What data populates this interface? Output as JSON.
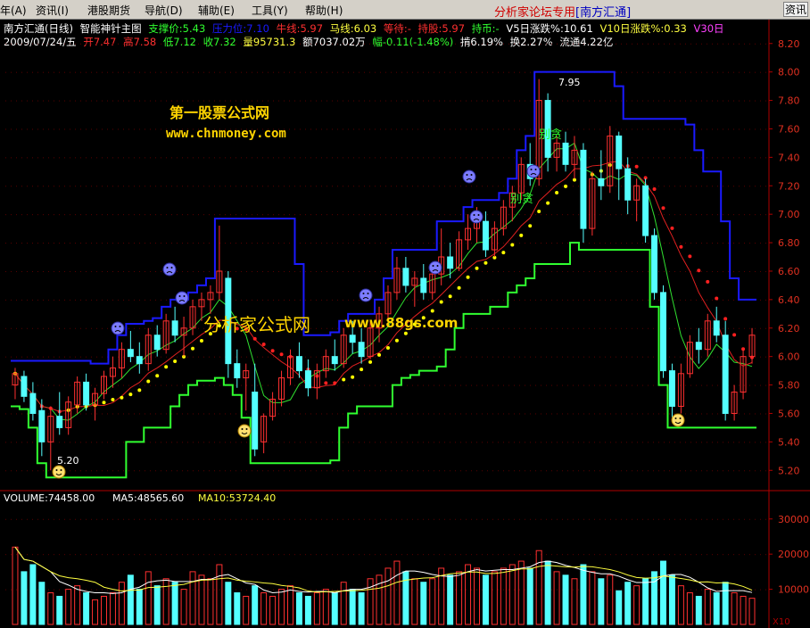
{
  "menu": {
    "items": [
      "年(A)",
      "资讯(I)",
      "港股期货",
      "导航(D)",
      "辅助(E)",
      "工具(Y)",
      "帮助(H)"
    ],
    "brand": "分析家论坛专用",
    "stock_tag": "[南方汇通]",
    "right_button": "资讯"
  },
  "header": {
    "title": "南方汇通(日线)",
    "indicator": "智能神针主图",
    "support": "支撑价:5.43",
    "pressure": "压力位:7.10",
    "niu": "牛线:5.97",
    "ma": "马线:6.03",
    "wait": "等待:-",
    "hold": "持股:5.97",
    "hold_cash": "持币:-",
    "v5": "V5日涨跌%:10.61",
    "v10": "V10日涨跌%:0.33",
    "v30": "V30日"
  },
  "quote": {
    "date": "2009/07/24/五",
    "open": "开7.47",
    "high": "高7.58",
    "low": "低7.12",
    "close": "收7.32",
    "vol": "量95731.3",
    "amount": "额7037.02万",
    "change": "幅-0.11(-1.48%)",
    "amplitude": "掯6.19%",
    "turnover": "换2.27%",
    "float": "流通4.22亿"
  },
  "watermarks": {
    "site1": "第一股票公式网",
    "url1": "www.chnmoney.com",
    "site2": "分析家公式网",
    "url2": "www.88gs.com"
  },
  "annotations": {
    "low_mark": "5.20",
    "high_mark": "7.95",
    "bietan1": "别贪",
    "bietan2": "别贪"
  },
  "volume_header": {
    "volume": "VOLUME:74458.00",
    "ma5": "MA5:48565.60",
    "ma10": "MA10:53724.40"
  },
  "volume_axis": [
    "30000",
    "20000",
    "10000"
  ],
  "volume_unit": "X10",
  "colors": {
    "up": "#ff3030",
    "down": "#54ffff",
    "pressure_line": "#1a1aff",
    "support_line": "#30ff30",
    "dots": "#ffff00",
    "red_dots": "#ff2020",
    "ma_green": "#30e030",
    "ma_red": "#e02020",
    "axis": "#b00000",
    "grid": "#5a0000"
  },
  "chart_data": {
    "type": "candlestick",
    "price_axis": {
      "ticks": [
        5.2,
        5.4,
        5.6,
        5.8,
        6.0,
        6.2,
        6.4,
        6.6,
        6.8,
        7.0,
        7.2,
        7.4,
        7.6,
        7.8,
        8.0,
        8.2
      ],
      "ylim": [
        5.07,
        8.28
      ]
    },
    "volume_axis": {
      "ticks": [
        10000,
        20000,
        30000
      ],
      "ylim": [
        0,
        34000
      ]
    },
    "candles": [
      [
        5.8,
        5.92,
        5.7,
        5.88,
        22000
      ],
      [
        5.86,
        5.9,
        5.68,
        5.72,
        15000
      ],
      [
        5.74,
        5.82,
        5.55,
        5.6,
        17000
      ],
      [
        5.62,
        5.7,
        5.3,
        5.4,
        12000
      ],
      [
        5.4,
        5.65,
        5.2,
        5.58,
        9000
      ],
      [
        5.58,
        5.75,
        5.45,
        5.5,
        8000
      ],
      [
        5.5,
        5.72,
        5.45,
        5.68,
        10000
      ],
      [
        5.66,
        5.86,
        5.6,
        5.82,
        11000
      ],
      [
        5.82,
        5.88,
        5.62,
        5.66,
        9000
      ],
      [
        5.66,
        5.78,
        5.55,
        5.74,
        7000
      ],
      [
        5.74,
        5.9,
        5.7,
        5.86,
        8000
      ],
      [
        5.86,
        6.0,
        5.78,
        5.92,
        9000
      ],
      [
        5.92,
        6.1,
        5.85,
        6.05,
        12000
      ],
      [
        6.05,
        6.18,
        5.96,
        6.0,
        14000
      ],
      [
        6.0,
        6.1,
        5.88,
        5.95,
        10000
      ],
      [
        5.95,
        6.2,
        5.9,
        6.15,
        15000
      ],
      [
        6.15,
        6.22,
        6.0,
        6.05,
        11000
      ],
      [
        6.05,
        6.3,
        6.02,
        6.25,
        13000
      ],
      [
        6.25,
        6.35,
        6.1,
        6.15,
        12000
      ],
      [
        6.15,
        6.28,
        6.0,
        6.2,
        10000
      ],
      [
        6.2,
        6.4,
        6.15,
        6.35,
        15000
      ],
      [
        6.35,
        6.45,
        6.25,
        6.4,
        14000
      ],
      [
        6.4,
        6.5,
        6.3,
        6.45,
        13000
      ],
      [
        6.45,
        6.92,
        6.4,
        6.6,
        17000
      ],
      [
        6.55,
        6.6,
        5.85,
        5.95,
        12000
      ],
      [
        5.95,
        6.05,
        5.78,
        5.85,
        9000
      ],
      [
        5.85,
        5.95,
        5.62,
        5.9,
        8000
      ],
      [
        5.75,
        5.95,
        5.3,
        5.35,
        11000
      ],
      [
        5.4,
        5.6,
        5.32,
        5.58,
        9000
      ],
      [
        5.58,
        5.75,
        5.55,
        5.7,
        8000
      ],
      [
        5.7,
        5.9,
        5.65,
        5.85,
        10000
      ],
      [
        5.85,
        6.05,
        5.8,
        6.0,
        11000
      ],
      [
        6.0,
        6.1,
        5.85,
        5.9,
        9000
      ],
      [
        5.9,
        5.98,
        5.72,
        5.78,
        8000
      ],
      [
        5.78,
        5.95,
        5.7,
        5.9,
        9000
      ],
      [
        5.9,
        6.05,
        5.85,
        6.0,
        10000
      ],
      [
        6.0,
        6.12,
        5.9,
        5.95,
        9000
      ],
      [
        5.95,
        6.2,
        5.92,
        6.15,
        12000
      ],
      [
        6.15,
        6.25,
        6.02,
        6.1,
        10000
      ],
      [
        6.1,
        6.2,
        5.95,
        6.0,
        9000
      ],
      [
        6.0,
        6.25,
        5.98,
        6.2,
        13000
      ],
      [
        6.2,
        6.35,
        6.1,
        6.3,
        14000
      ],
      [
        6.3,
        6.5,
        6.25,
        6.45,
        16000
      ],
      [
        6.45,
        6.7,
        6.4,
        6.62,
        18000
      ],
      [
        6.62,
        6.7,
        6.45,
        6.5,
        15000
      ],
      [
        6.5,
        6.6,
        6.35,
        6.55,
        13000
      ],
      [
        6.55,
        6.65,
        6.4,
        6.45,
        12000
      ],
      [
        6.45,
        6.62,
        6.4,
        6.58,
        13000
      ],
      [
        6.58,
        6.9,
        6.5,
        6.7,
        16000
      ],
      [
        6.7,
        6.8,
        6.55,
        6.62,
        14000
      ],
      [
        6.62,
        6.88,
        6.6,
        6.82,
        15000
      ],
      [
        6.82,
        7.0,
        6.75,
        6.9,
        17000
      ],
      [
        6.9,
        7.05,
        6.8,
        6.95,
        16000
      ],
      [
        6.95,
        7.02,
        6.7,
        6.75,
        14000
      ],
      [
        6.75,
        6.95,
        6.7,
        6.9,
        15000
      ],
      [
        6.9,
        7.1,
        6.85,
        7.05,
        16000
      ],
      [
        7.05,
        7.2,
        6.95,
        7.15,
        17000
      ],
      [
        7.15,
        7.4,
        7.1,
        7.35,
        18000
      ],
      [
        7.35,
        7.5,
        7.2,
        7.25,
        16000
      ],
      [
        7.25,
        7.95,
        7.2,
        7.8,
        21000
      ],
      [
        7.8,
        7.85,
        7.3,
        7.4,
        18000
      ],
      [
        7.4,
        7.55,
        7.3,
        7.5,
        15000
      ],
      [
        7.5,
        7.58,
        7.3,
        7.35,
        14000
      ],
      [
        7.35,
        7.55,
        7.25,
        7.45,
        13000
      ],
      [
        7.45,
        7.5,
        6.8,
        6.9,
        17000
      ],
      [
        6.9,
        7.3,
        6.85,
        7.25,
        15000
      ],
      [
        7.25,
        7.45,
        7.1,
        7.2,
        13000
      ],
      [
        7.2,
        7.62,
        7.15,
        7.55,
        14000
      ],
      [
        7.55,
        7.58,
        7.1,
        7.32,
        9573
      ],
      [
        7.32,
        7.4,
        7.0,
        7.1,
        12000
      ],
      [
        7.1,
        7.25,
        6.95,
        7.2,
        11000
      ],
      [
        7.2,
        7.25,
        6.8,
        6.85,
        13000
      ],
      [
        6.85,
        6.9,
        6.4,
        6.45,
        15000
      ],
      [
        6.45,
        6.5,
        5.85,
        5.9,
        18000
      ],
      [
        5.9,
        5.95,
        5.55,
        5.65,
        14000
      ],
      [
        5.65,
        5.95,
        5.6,
        5.88,
        11000
      ],
      [
        5.88,
        6.15,
        5.85,
        6.1,
        9000
      ],
      [
        6.1,
        6.2,
        5.95,
        6.05,
        8000
      ],
      [
        6.05,
        6.3,
        6.0,
        6.25,
        10000
      ],
      [
        6.25,
        6.35,
        6.1,
        6.15,
        9000
      ],
      [
        6.15,
        6.25,
        5.55,
        5.6,
        12000
      ],
      [
        5.6,
        5.8,
        5.55,
        5.75,
        9000
      ],
      [
        5.75,
        6.05,
        5.7,
        6.0,
        8000
      ],
      [
        6.0,
        6.2,
        5.95,
        6.15,
        7445
      ]
    ]
  }
}
